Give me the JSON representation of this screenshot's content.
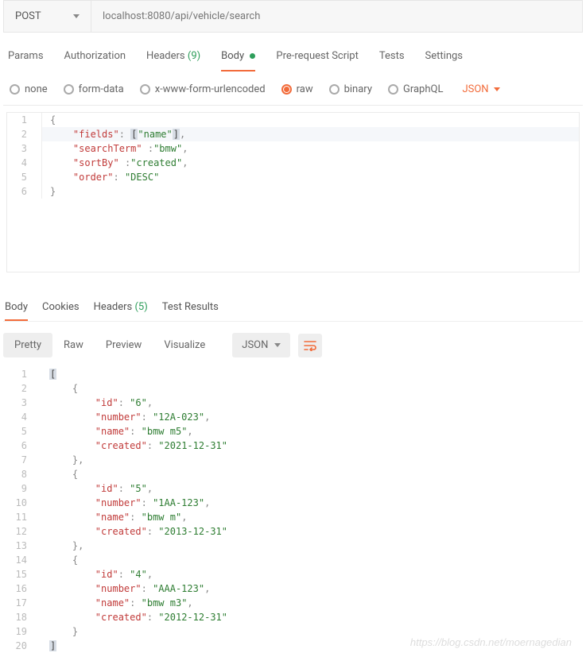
{
  "request": {
    "method": "POST",
    "url": "localhost:8080/api/vehicle/search"
  },
  "request_tabs": {
    "params": "Params",
    "authorization": "Authorization",
    "headers_label": "Headers",
    "headers_count": "(9)",
    "body": "Body",
    "prerequest": "Pre-request Script",
    "tests": "Tests",
    "settings": "Settings"
  },
  "body_options": {
    "none": "none",
    "form_data": "form-data",
    "x_www": "x-www-form-urlencoded",
    "raw": "raw",
    "binary": "binary",
    "graphql": "GraphQL",
    "type_label": "JSON"
  },
  "request_body_lines": [
    {
      "n": "1",
      "html": "<span class='tok-brace'>{</span>"
    },
    {
      "n": "2",
      "html": "    <span class='tok-key'>\"fields\"</span><span class='tok-punct'>:</span> <span class='tok-hl-bracket'>[</span><span class='tok-str'>\"name\"</span><span class='tok-hl-bracket'>]</span><span class='tok-punct'>,</span>",
      "active": true
    },
    {
      "n": "3",
      "html": "    <span class='tok-key'>\"searchTerm\"</span> <span class='tok-punct'>:</span><span class='tok-str'>\"bmw\"</span><span class='tok-punct'>,</span>"
    },
    {
      "n": "4",
      "html": "    <span class='tok-key'>\"sortBy\"</span> <span class='tok-punct'>:</span><span class='tok-str'>\"created\"</span><span class='tok-punct'>,</span>"
    },
    {
      "n": "5",
      "html": "    <span class='tok-key'>\"order\"</span><span class='tok-punct'>:</span> <span class='tok-str'>\"DESC\"</span>"
    },
    {
      "n": "6",
      "html": "<span class='tok-brace'>}</span>"
    }
  ],
  "response_tabs": {
    "body": "Body",
    "cookies": "Cookies",
    "headers_label": "Headers",
    "headers_count": "(5)",
    "test_results": "Test Results"
  },
  "response_toolbar": {
    "pretty": "Pretty",
    "raw": "Raw",
    "preview": "Preview",
    "visualize": "Visualize",
    "type": "JSON"
  },
  "response_body_lines": [
    {
      "n": "1",
      "html": "<span class='tok-rbracket-hl'>[</span>"
    },
    {
      "n": "2",
      "html": "    <span class='tok-rbrace'>{</span>"
    },
    {
      "n": "3",
      "html": "        <span class='tok-rkey'>\"id\"</span><span class='tok-rpunct'>:</span> <span class='tok-rstr'>\"6\"</span><span class='tok-rpunct'>,</span>"
    },
    {
      "n": "4",
      "html": "        <span class='tok-rkey'>\"number\"</span><span class='tok-rpunct'>:</span> <span class='tok-rstr'>\"12A-023\"</span><span class='tok-rpunct'>,</span>"
    },
    {
      "n": "5",
      "html": "        <span class='tok-rkey'>\"name\"</span><span class='tok-rpunct'>:</span> <span class='tok-rstr'>\"bmw m5\"</span><span class='tok-rpunct'>,</span>"
    },
    {
      "n": "6",
      "html": "        <span class='tok-rkey'>\"created\"</span><span class='tok-rpunct'>:</span> <span class='tok-rstr'>\"2021-12-31\"</span>"
    },
    {
      "n": "7",
      "html": "    <span class='tok-rbrace'>}</span><span class='tok-rpunct'>,</span>"
    },
    {
      "n": "8",
      "html": "    <span class='tok-rbrace'>{</span>"
    },
    {
      "n": "9",
      "html": "        <span class='tok-rkey'>\"id\"</span><span class='tok-rpunct'>:</span> <span class='tok-rstr'>\"5\"</span><span class='tok-rpunct'>,</span>"
    },
    {
      "n": "10",
      "html": "        <span class='tok-rkey'>\"number\"</span><span class='tok-rpunct'>:</span> <span class='tok-rstr'>\"1AA-123\"</span><span class='tok-rpunct'>,</span>"
    },
    {
      "n": "11",
      "html": "        <span class='tok-rkey'>\"name\"</span><span class='tok-rpunct'>:</span> <span class='tok-rstr'>\"bmw m\"</span><span class='tok-rpunct'>,</span>"
    },
    {
      "n": "12",
      "html": "        <span class='tok-rkey'>\"created\"</span><span class='tok-rpunct'>:</span> <span class='tok-rstr'>\"2013-12-31\"</span>"
    },
    {
      "n": "13",
      "html": "    <span class='tok-rbrace'>}</span><span class='tok-rpunct'>,</span>"
    },
    {
      "n": "14",
      "html": "    <span class='tok-rbrace'>{</span>"
    },
    {
      "n": "15",
      "html": "        <span class='tok-rkey'>\"id\"</span><span class='tok-rpunct'>:</span> <span class='tok-rstr'>\"4\"</span><span class='tok-rpunct'>,</span>"
    },
    {
      "n": "16",
      "html": "        <span class='tok-rkey'>\"number\"</span><span class='tok-rpunct'>:</span> <span class='tok-rstr'>\"AAA-123\"</span><span class='tok-rpunct'>,</span>"
    },
    {
      "n": "17",
      "html": "        <span class='tok-rkey'>\"name\"</span><span class='tok-rpunct'>:</span> <span class='tok-rstr'>\"bmw m3\"</span><span class='tok-rpunct'>,</span>"
    },
    {
      "n": "18",
      "html": "        <span class='tok-rkey'>\"created\"</span><span class='tok-rpunct'>:</span> <span class='tok-rstr'>\"2012-12-31\"</span>"
    },
    {
      "n": "19",
      "html": "    <span class='tok-rbrace'>}</span>"
    },
    {
      "n": "20",
      "html": "<span class='tok-rbracket-hl'>]</span>"
    }
  ],
  "watermark": "https://blog.csdn.net/moernagedian"
}
